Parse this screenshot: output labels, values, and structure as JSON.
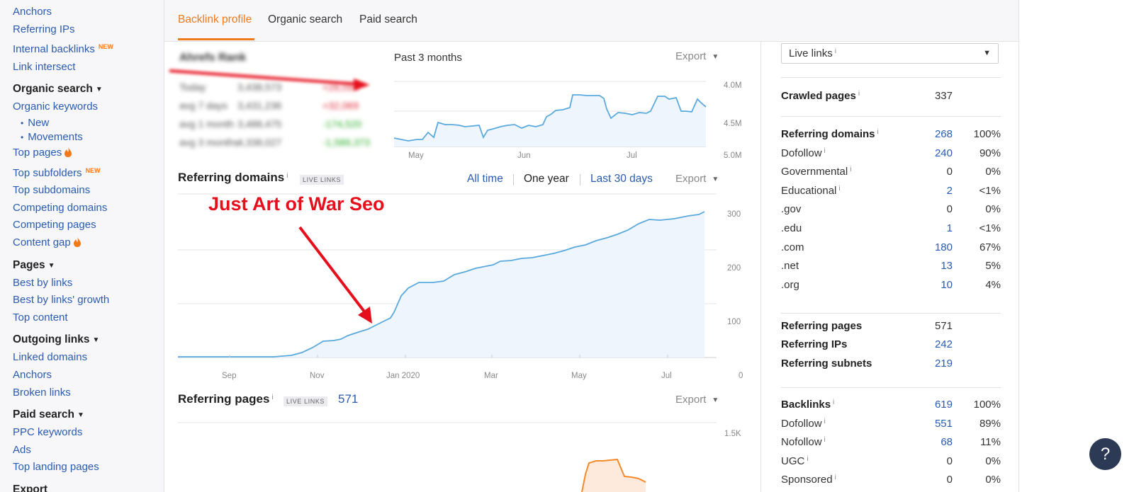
{
  "sidebar": {
    "items": [
      {
        "type": "link",
        "label": "Anchors"
      },
      {
        "type": "link",
        "label": "Referring IPs"
      },
      {
        "type": "link",
        "label": "Internal backlinks",
        "badge": "NEW"
      },
      {
        "type": "link",
        "label": "Link intersect"
      },
      {
        "type": "header",
        "label": "Organic search"
      },
      {
        "type": "link",
        "label": "Organic keywords"
      },
      {
        "type": "sub",
        "label": "New"
      },
      {
        "type": "sub",
        "label": "Movements"
      },
      {
        "type": "link",
        "label": "Top pages",
        "fire": true
      },
      {
        "type": "link",
        "label": "Top subfolders",
        "badge": "NEW"
      },
      {
        "type": "link",
        "label": "Top subdomains"
      },
      {
        "type": "link",
        "label": "Competing domains"
      },
      {
        "type": "link",
        "label": "Competing pages"
      },
      {
        "type": "link",
        "label": "Content gap",
        "fire": true
      },
      {
        "type": "header",
        "label": "Pages"
      },
      {
        "type": "link",
        "label": "Best by links"
      },
      {
        "type": "link",
        "label": "Best by links' growth"
      },
      {
        "type": "link",
        "label": "Top content"
      },
      {
        "type": "header",
        "label": "Outgoing links"
      },
      {
        "type": "link",
        "label": "Linked domains"
      },
      {
        "type": "link",
        "label": "Anchors"
      },
      {
        "type": "link",
        "label": "Broken links"
      },
      {
        "type": "header",
        "label": "Paid search"
      },
      {
        "type": "link",
        "label": "PPC keywords"
      },
      {
        "type": "link",
        "label": "Ads"
      },
      {
        "type": "link",
        "label": "Top landing pages"
      },
      {
        "type": "header",
        "label": "Export"
      }
    ]
  },
  "tabs": [
    {
      "label": "Backlink profile",
      "active": true
    },
    {
      "label": "Organic search",
      "active": false
    },
    {
      "label": "Paid search",
      "active": false
    }
  ],
  "traffic": {
    "period": "Past 3 months",
    "export": "Export",
    "blurred_title": "Ahrefs Rank",
    "blurred_rows": [
      [
        "Today",
        "3,438,573",
        "+28,093"
      ],
      [
        "avg 7 days",
        "3,431,236",
        "+32,069"
      ],
      [
        "avg 1 month",
        "3,488,475",
        "-174,520"
      ],
      [
        "avg 3 months",
        "4,338,027",
        "-1,589,373"
      ]
    ],
    "y_labels": [
      "4.0M",
      "4.5M",
      "5.0M"
    ],
    "x_labels": [
      "May",
      "Jun",
      "Jul"
    ]
  },
  "referring_domains_section": {
    "title": "Referring domains",
    "info": "i",
    "badge": "LIVE LINKS",
    "ranges": [
      "All time",
      "One year",
      "Last 30 days"
    ],
    "active_range": "One year",
    "export": "Export",
    "y_labels": [
      "300",
      "200",
      "100",
      "0"
    ],
    "x_labels": [
      "Sep",
      "Nov",
      "Jan 2020",
      "Mar",
      "May",
      "Jul"
    ],
    "annotation": "Just Art of War Seo"
  },
  "referring_pages_section": {
    "title": "Referring pages",
    "info": "i",
    "badge": "LIVE LINKS",
    "count": "571",
    "export": "Export",
    "y_label_top": "1.5K"
  },
  "stats": {
    "select_label": "Live links",
    "select_info": "i",
    "crawled": {
      "label": "Crawled pages",
      "value": "337"
    },
    "ref_domains": [
      {
        "label": "Referring domains",
        "value": "268",
        "pct": "100%",
        "bold": true,
        "info": true
      },
      {
        "label": "Dofollow",
        "value": "240",
        "pct": "90%",
        "info": true
      },
      {
        "label": "Governmental",
        "value": "0",
        "pct": "0%",
        "info": true
      },
      {
        "label": "Educational",
        "value": "2",
        "pct": "<1%",
        "info": true
      },
      {
        "label": ".gov",
        "value": "0",
        "pct": "0%"
      },
      {
        "label": ".edu",
        "value": "1",
        "pct": "<1%"
      },
      {
        "label": ".com",
        "value": "180",
        "pct": "67%"
      },
      {
        "label": ".net",
        "value": "13",
        "pct": "5%"
      },
      {
        "label": ".org",
        "value": "10",
        "pct": "4%"
      }
    ],
    "refs": [
      {
        "label": "Referring pages",
        "value": "571"
      },
      {
        "label": "Referring IPs",
        "value": "242"
      },
      {
        "label": "Referring subnets",
        "value": "219"
      }
    ],
    "backlinks": [
      {
        "label": "Backlinks",
        "value": "619",
        "pct": "100%",
        "bold": true,
        "info": true
      },
      {
        "label": "Dofollow",
        "value": "551",
        "pct": "89%",
        "info": true
      },
      {
        "label": "Nofollow",
        "value": "68",
        "pct": "11%",
        "info": true
      },
      {
        "label": "UGC",
        "value": "0",
        "pct": "0%",
        "info": true
      },
      {
        "label": "Sponsored",
        "value": "0",
        "pct": "0%",
        "info": true
      }
    ]
  },
  "help_label": "?",
  "colors": {
    "accent": "#f07a1a",
    "link": "#2a5bb0",
    "chart_line": "#5aa9dd",
    "chart_fill": "#eef5fc",
    "annotation": "#e6101d",
    "pages_line": "#f58a2a"
  }
}
